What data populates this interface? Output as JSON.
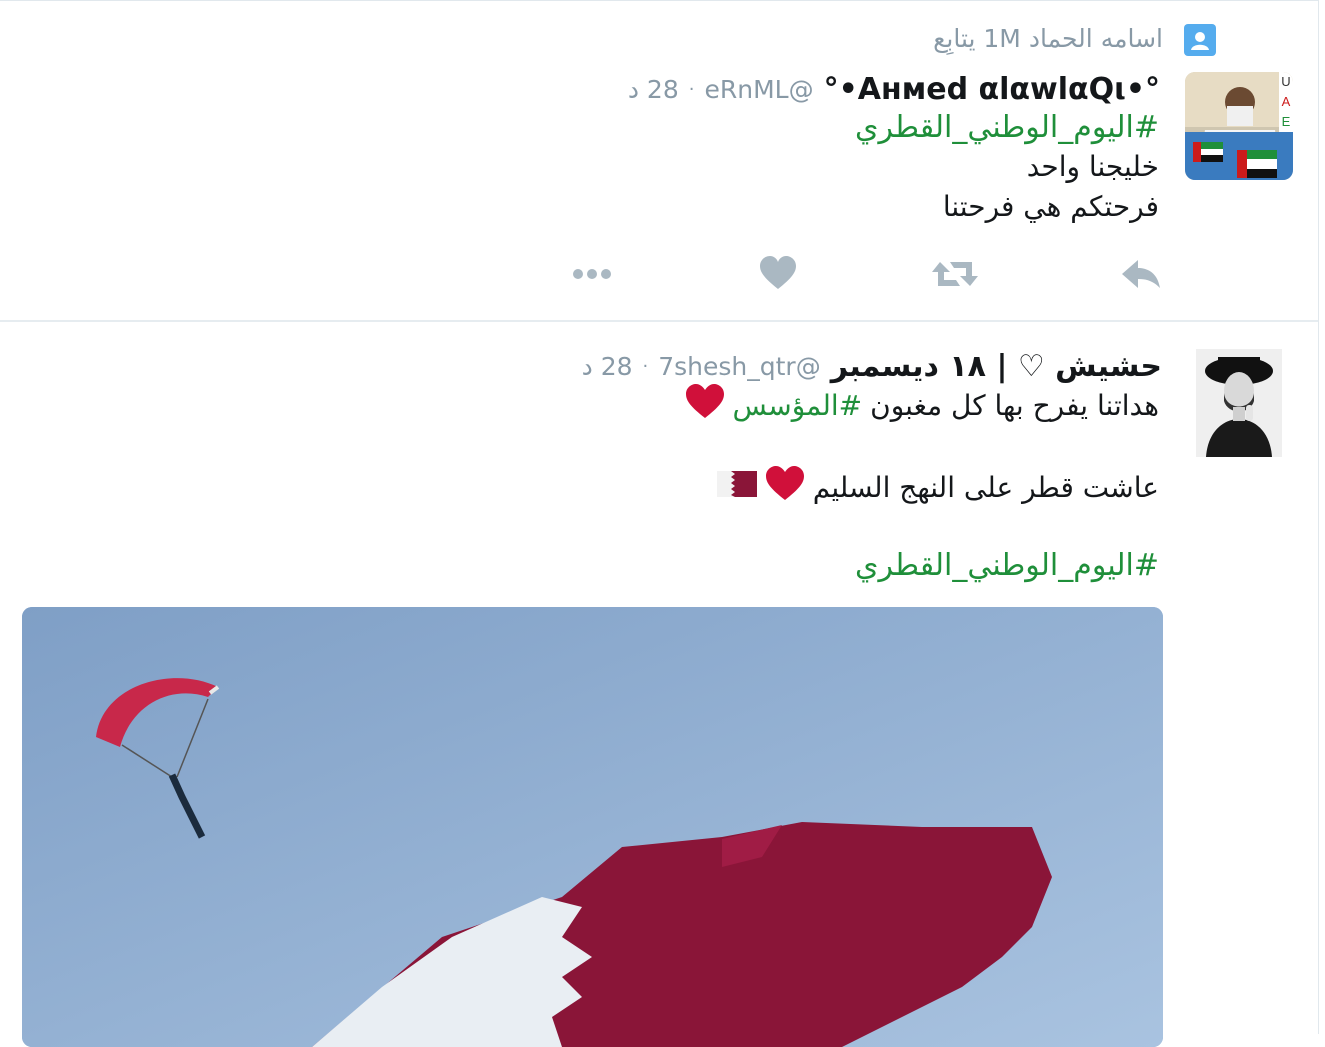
{
  "tweet1": {
    "context": "اسامه الحماد 1M يتابِع",
    "name": "°•Aнмed αlαwlαQι•°",
    "handle": "@eRnML",
    "dot": "·",
    "time": "28 د",
    "hashtag": "#اليوم_الوطني_القطري",
    "lines": [
      "خليجنا واحد",
      "فرحتكم هي فرحتنا"
    ],
    "avatar_letters": [
      "U",
      "A",
      "E"
    ]
  },
  "tweet2": {
    "name": "حشيش ♡ | ١٨ ديسمبر",
    "handle": "@7shesh_qtr",
    "dot": "·",
    "time": "28 د",
    "line1_text": "هداتنا يفرح بها كل مغبون",
    "line1_hashtag": "#المؤسس",
    "line2_text": "عاشت قطر على النهج السليم",
    "hashtag": "#اليوم_الوطني_القطري"
  },
  "colors": {
    "hashtag": "#1f8f3a",
    "meta": "#8899a6",
    "icon": "#aab8c2",
    "heart": "#d0103a",
    "qatar_maroon": "#8a1538"
  },
  "icons": [
    "follow-user-icon",
    "reply-icon",
    "retweet-icon",
    "like-icon",
    "more-icon"
  ]
}
